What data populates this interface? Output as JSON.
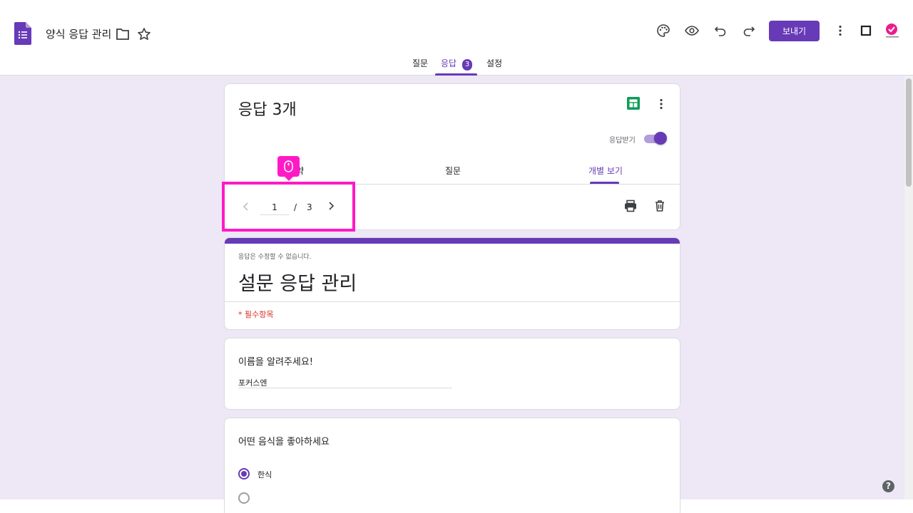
{
  "header": {
    "title": "양식 응답 관리",
    "send_label": "보내기",
    "icons": [
      "forms-logo-icon",
      "folder-icon",
      "star-icon",
      "palette-icon",
      "eye-icon",
      "undo-icon",
      "redo-icon",
      "more-vert-icon",
      "square-icon"
    ]
  },
  "nav": {
    "questions": "질문",
    "responses": "응답",
    "responses_count": "3",
    "settings": "설정"
  },
  "summary": {
    "title": "응답 3개",
    "accepting_label": "응답받기",
    "accepting": true,
    "tabs": {
      "summary": "약",
      "question": "질문",
      "individual": "개별 보기"
    },
    "pager": {
      "current": "1",
      "separator": "/",
      "total": "3"
    }
  },
  "form": {
    "readonly_note": "응답은 수정할 수 없습니다.",
    "title": "설문 응답 관리",
    "required_note": "* 필수항목"
  },
  "questions": [
    {
      "text": "이름을 알려주세요!",
      "answer": "포커스엔"
    },
    {
      "text": "어떤 음식을 좋아하세요",
      "selected_option": "한식"
    }
  ],
  "help": "?",
  "colors": {
    "accent": "#673ab7",
    "highlight": "#ff1ac6",
    "background": "#ede7f6",
    "required": "#d93025"
  }
}
